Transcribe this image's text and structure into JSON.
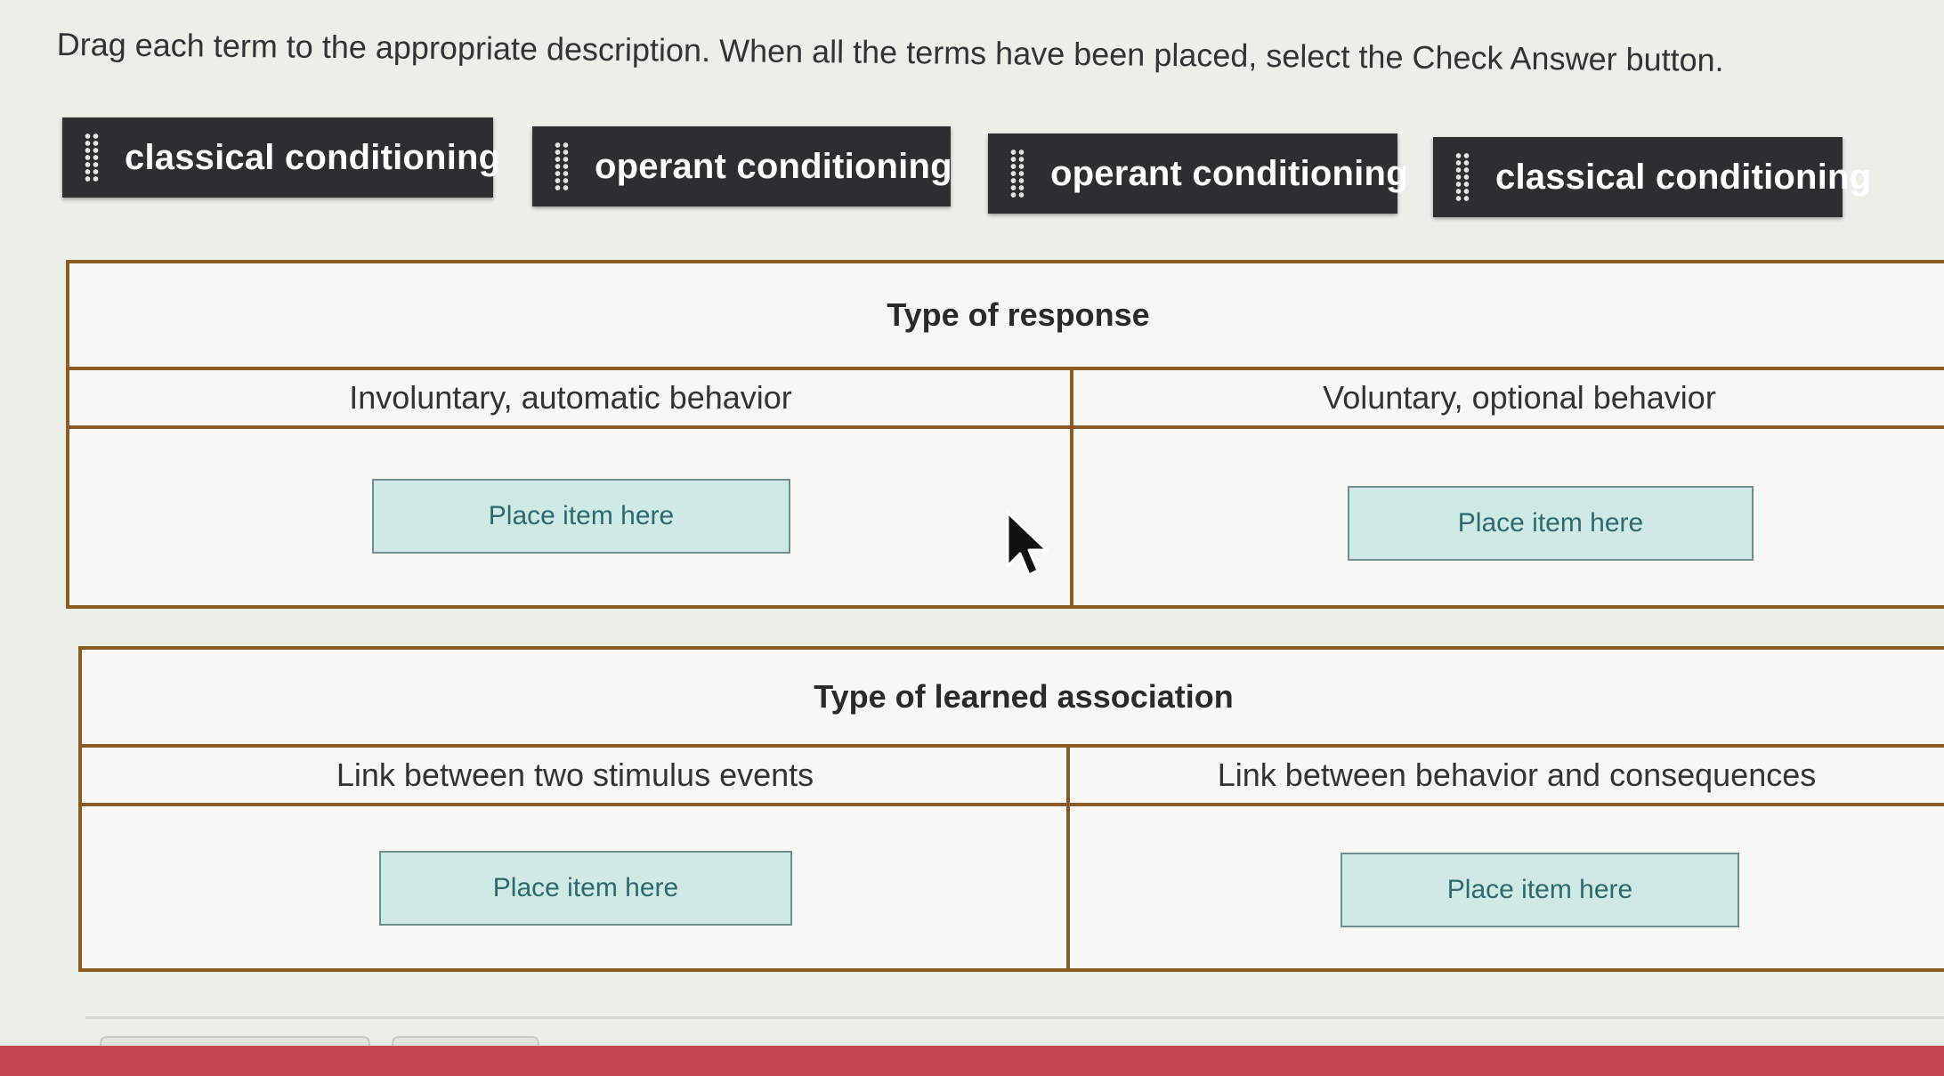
{
  "instructions": "Drag each term to the appropriate description. When all the terms have been placed, select the Check Answer button.",
  "terms": [
    {
      "label": "classical conditioning"
    },
    {
      "label": "operant conditioning"
    },
    {
      "label": "operant conditioning"
    },
    {
      "label": "classical conditioning"
    }
  ],
  "tables": [
    {
      "title": "Type of response",
      "columns": [
        {
          "header": "Involuntary, automatic behavior",
          "placeholder": "Place item here"
        },
        {
          "header": "Voluntary, optional behavior",
          "placeholder": "Place item here"
        }
      ]
    },
    {
      "title": "Type of learned association",
      "columns": [
        {
          "header": "Link between two stimulus events",
          "placeholder": "Place item here"
        },
        {
          "header": "Link between behavior and consequences",
          "placeholder": "Place item here"
        }
      ]
    }
  ],
  "colors": {
    "chip": "#2e2e30",
    "table_border": "#8c5a23",
    "drop_zone": "#cfe9e4",
    "drop_text": "#2c6a70",
    "footer_bar": "#c3474f"
  },
  "icons": [
    "drag-handle-icon",
    "mouse-pointer-icon"
  ]
}
